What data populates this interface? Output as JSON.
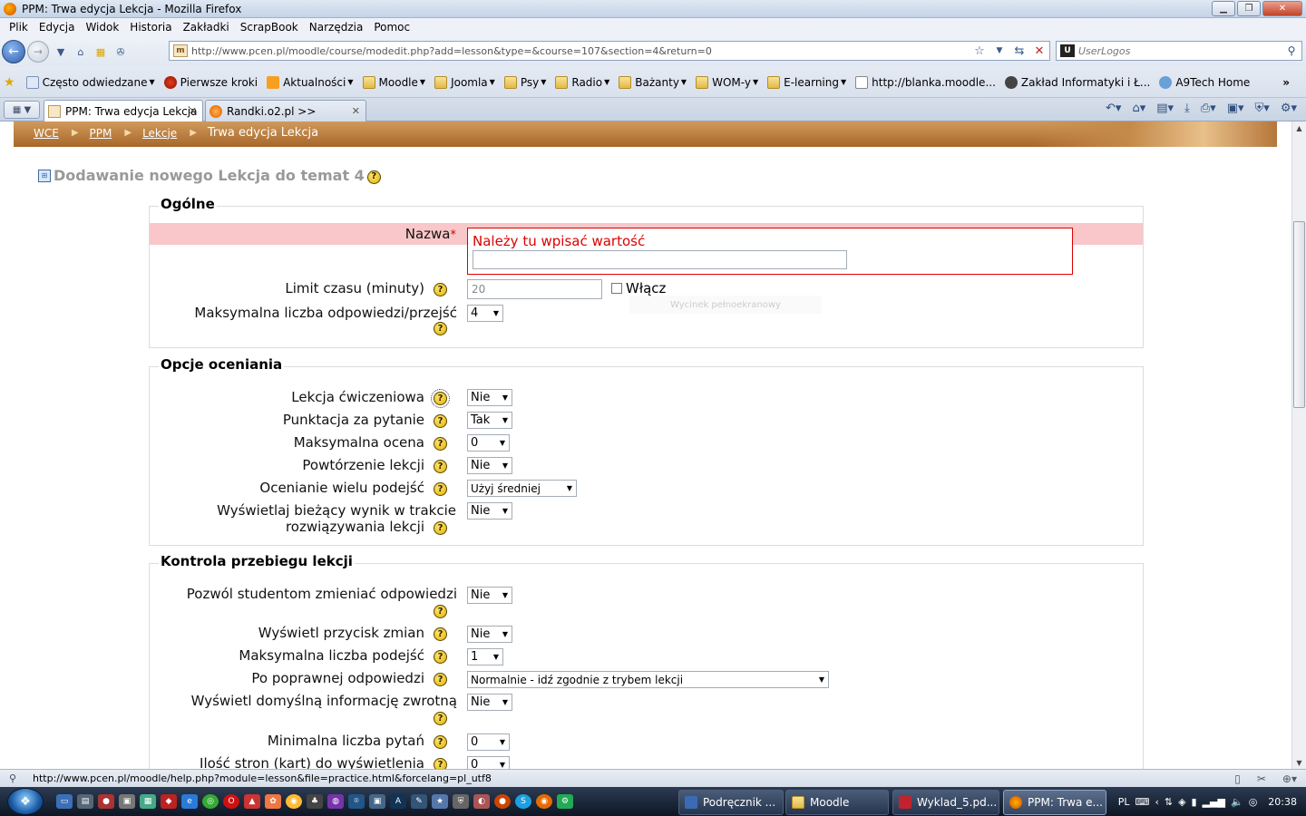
{
  "window": {
    "title": "PPM: Trwa edycja Lekcja - Mozilla Firefox"
  },
  "menubar": [
    "Plik",
    "Edycja",
    "Widok",
    "Historia",
    "Zakładki",
    "ScrapBook",
    "Narzędzia",
    "Pomoc"
  ],
  "navbar": {
    "url": "http://www.pcen.pl/moodle/course/modedit.php?add=lesson&type=&course=107&section=4&return=0",
    "search_placeholder": "UserLogos"
  },
  "bookmarks": [
    {
      "label": "Często odwiedzane",
      "dropdown": true,
      "icon": "page-icon"
    },
    {
      "label": "Pierwsze kroki",
      "dropdown": false,
      "icon": "firefox-icon"
    },
    {
      "label": "Aktualności",
      "dropdown": true,
      "icon": "rss-icon"
    },
    {
      "label": "Moodle",
      "dropdown": true,
      "icon": "folder-icon"
    },
    {
      "label": "Joomla",
      "dropdown": true,
      "icon": "folder-icon"
    },
    {
      "label": "Psy",
      "dropdown": true,
      "icon": "folder-icon"
    },
    {
      "label": "Radio",
      "dropdown": true,
      "icon": "folder-icon"
    },
    {
      "label": "Bażanty",
      "dropdown": true,
      "icon": "folder-icon"
    },
    {
      "label": "WOM-y",
      "dropdown": true,
      "icon": "folder-icon"
    },
    {
      "label": "E-learning",
      "dropdown": true,
      "icon": "folder-icon"
    },
    {
      "label": "http://blanka.moodle...",
      "dropdown": false,
      "icon": "page-icon"
    },
    {
      "label": "Zakład Informatyki i Ł...",
      "dropdown": false,
      "icon": "link-icon"
    },
    {
      "label": "A9Tech Home",
      "dropdown": false,
      "icon": "link-icon"
    }
  ],
  "tabs": [
    {
      "label": "PPM: Trwa edycja Lekcja",
      "active": true
    },
    {
      "label": "Randki.o2.pl >>",
      "active": false
    }
  ],
  "breadcrumb": {
    "items": [
      "WCE",
      "PPM",
      "Lekcje"
    ],
    "current": "Trwa edycja Lekcja"
  },
  "page": {
    "heading": "Dodawanie nowego Lekcja do temat 4"
  },
  "sections": {
    "general": {
      "legend": "Ogólne",
      "name_label": "Nazwa",
      "name_required": "*",
      "name_error": "Należy tu wpisać wartość",
      "name_value": "",
      "timelimit_label": "Limit czasu (minuty)",
      "timelimit_value": "20",
      "enable_label": "Włącz",
      "maxanswers_label": "Maksymalna liczba odpowiedzi/przejść",
      "maxanswers_value": "4",
      "ghost_tooltip": "Wycinek pełnoekranowy"
    },
    "grading": {
      "legend": "Opcje oceniania",
      "fields": [
        {
          "label": "Lekcja ćwiczeniowa",
          "value": "Nie"
        },
        {
          "label": "Punktacja za pytanie",
          "value": "Tak"
        },
        {
          "label": "Maksymalna ocena",
          "value": "0"
        },
        {
          "label": "Powtórzenie lekcji",
          "value": "Nie"
        },
        {
          "label": "Ocenianie wielu podejść",
          "value": "Użyj średniej"
        },
        {
          "label_line1": "Wyświetlaj bieżący wynik w trakcie",
          "label_line2": "rozwiązywania lekcji",
          "value": "Nie"
        }
      ]
    },
    "flow": {
      "legend": "Kontrola przebiegu lekcji",
      "fields": [
        {
          "label": "Pozwól studentom zmieniać odpowiedzi",
          "value": "Nie"
        },
        {
          "label": "Wyświetl przycisk zmian",
          "value": "Nie"
        },
        {
          "label": "Maksymalna liczba podejść",
          "value": "1"
        },
        {
          "label": "Po poprawnej odpowiedzi",
          "value": "Normalnie - idź zgodnie z trybem lekcji"
        },
        {
          "label": "Wyświetl domyślną informację zwrotną",
          "value": "Nie"
        },
        {
          "label": "Minimalna liczba pytań",
          "value": "0"
        },
        {
          "label": "Ilość stron (kart) do wyświetlenia",
          "value": "0"
        }
      ]
    }
  },
  "status": {
    "url": "http://www.pcen.pl/moodle/help.php?module=lesson&file=practice.html&forcelang=pl_utf8"
  },
  "taskbar": {
    "tasks": [
      {
        "label": "Podręcznik ..."
      },
      {
        "label": "Moodle"
      },
      {
        "label": "Wyklad_5.pd..."
      },
      {
        "label": "PPM: Trwa e..."
      }
    ],
    "lang": "PL",
    "clock": "20:38"
  },
  "colors": {
    "error_text": "#dd0000",
    "error_row_bg": "#f9c7c9",
    "header_brown": "#b9773a",
    "help_yellow": "#f2c81e"
  }
}
